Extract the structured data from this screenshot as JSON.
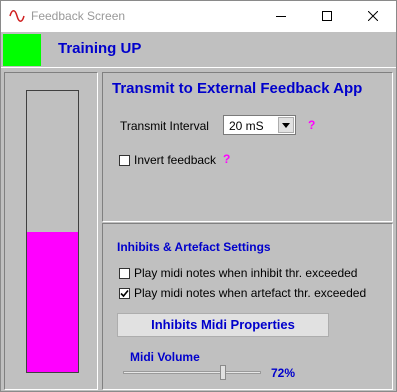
{
  "window": {
    "title": "Feedback Screen",
    "icon": "waveform-icon"
  },
  "status": {
    "color": "#00ff00",
    "text": "Training UP"
  },
  "feedback_bar": {
    "level_fraction": 0.5,
    "color": "#ff00ff"
  },
  "transmit": {
    "title": "Transmit to External Feedback App",
    "interval_label": "Transmit Interval",
    "interval_value": "20 mS",
    "help": "?",
    "invert_label": "Invert feedback",
    "invert_checked": false,
    "invert_help": "?"
  },
  "inhibits": {
    "title": "Inhibits & Artefact Settings",
    "inhibit_label": "Play midi notes when inhibit thr. exceeded",
    "inhibit_checked": false,
    "artefact_label": "Play midi notes when artefact thr. exceeded",
    "artefact_checked": true,
    "properties_button": "Inhibits Midi Properties"
  },
  "midi": {
    "label": "Midi Volume",
    "value": 72,
    "value_text": "72%"
  },
  "colors": {
    "accent": "#0000cc",
    "help": "#ff00ff",
    "panel": "#c0c0c0"
  }
}
